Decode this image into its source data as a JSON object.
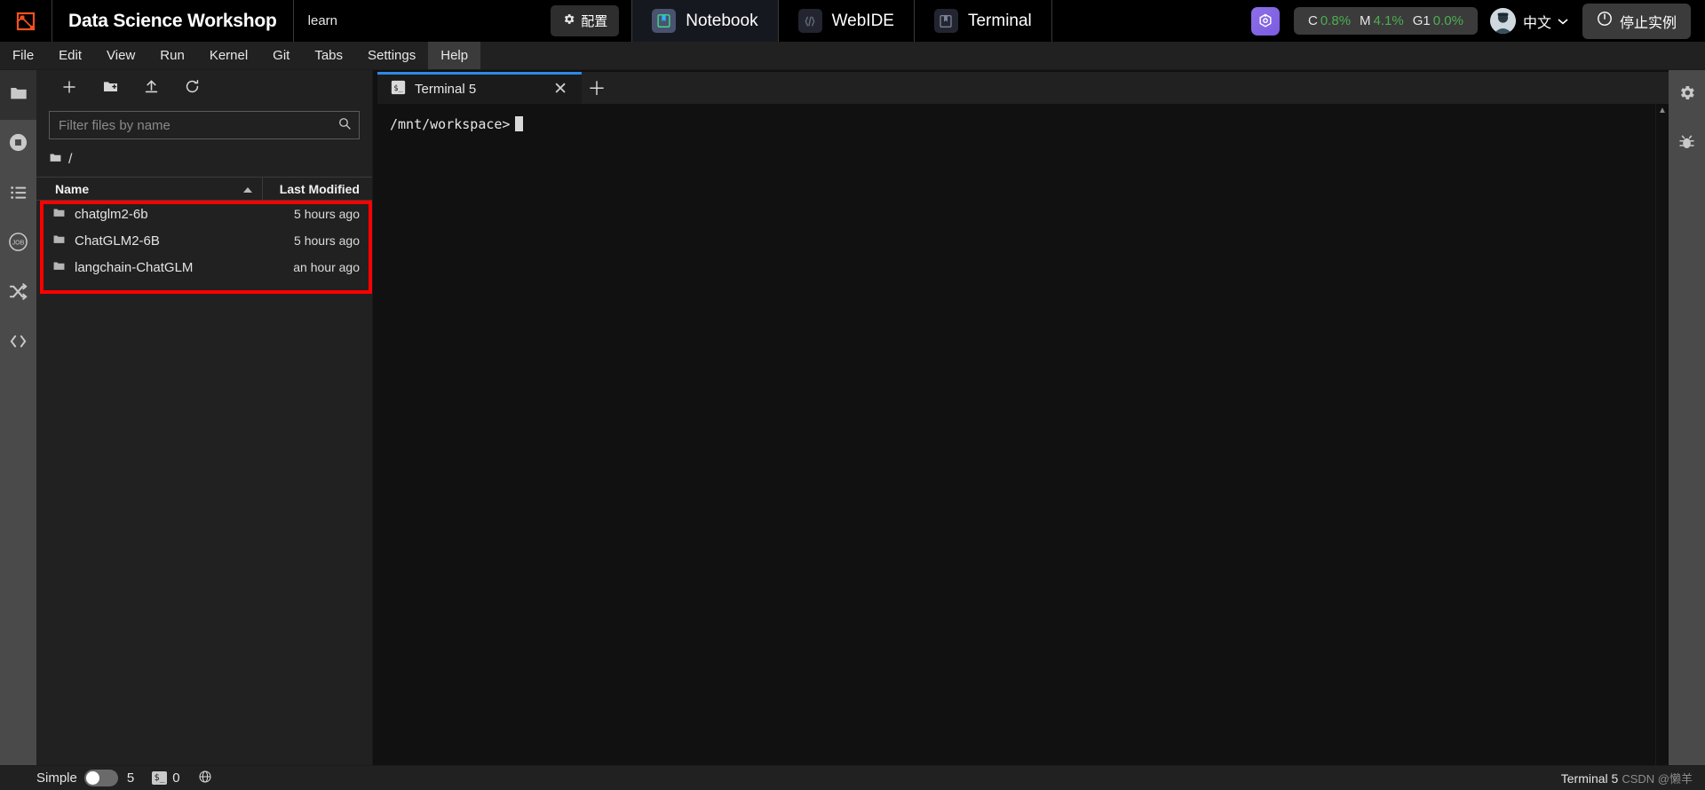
{
  "topbar": {
    "logo_icon": "workshop-logo-icon",
    "title": "Data Science Workshop",
    "subtitle": "learn",
    "config_button": {
      "label": "配置",
      "icon": "gear-icon"
    },
    "apps": [
      {
        "label": "Notebook",
        "icon": "notebook-icon",
        "active": true
      },
      {
        "label": "WebIDE",
        "icon": "code-brackets-icon",
        "active": false
      },
      {
        "label": "Terminal",
        "icon": "terminal-app-icon",
        "active": false
      }
    ],
    "ai_assistant_icon": "ai-assistant-icon",
    "stats": [
      {
        "key": "C",
        "value": "0.8%"
      },
      {
        "key": "M",
        "value": "4.1%"
      },
      {
        "key": "G1",
        "value": "0.0%"
      }
    ],
    "stats_value_color": "#4caf50",
    "avatar_icon": "user-avatar",
    "language": {
      "label": "中文",
      "icon": "chevron-down-icon"
    },
    "stop_button": {
      "label": "停止实例",
      "icon": "power-icon"
    }
  },
  "menubar": {
    "items": [
      {
        "label": "File",
        "active": false
      },
      {
        "label": "Edit",
        "active": false
      },
      {
        "label": "View",
        "active": false
      },
      {
        "label": "Run",
        "active": false
      },
      {
        "label": "Kernel",
        "active": false
      },
      {
        "label": "Git",
        "active": false
      },
      {
        "label": "Tabs",
        "active": false
      },
      {
        "label": "Settings",
        "active": false
      },
      {
        "label": "Help",
        "active": true
      }
    ]
  },
  "left_rail": {
    "items": [
      {
        "name": "file-browser",
        "icon": "folder-icon",
        "active": true
      },
      {
        "name": "running-terminals",
        "icon": "stop-circle-icon",
        "active": false
      },
      {
        "name": "table-of-contents",
        "icon": "list-icon",
        "active": false
      },
      {
        "name": "jobs",
        "icon": "job-icon",
        "active": false
      },
      {
        "name": "extension-manager",
        "icon": "shuffle-icon",
        "active": false
      },
      {
        "name": "code-snippets",
        "icon": "code-tags-icon",
        "active": false
      }
    ]
  },
  "right_rail": {
    "items": [
      {
        "name": "property-inspector",
        "icon": "gear-icon"
      },
      {
        "name": "debugger",
        "icon": "bug-icon"
      }
    ]
  },
  "file_browser": {
    "toolbar": [
      {
        "name": "new-launcher",
        "icon": "plus-icon"
      },
      {
        "name": "new-folder",
        "icon": "new-folder-icon"
      },
      {
        "name": "upload-files",
        "icon": "upload-icon"
      },
      {
        "name": "refresh-file-list",
        "icon": "refresh-icon"
      }
    ],
    "filter": {
      "placeholder": "Filter files by name",
      "value": "",
      "icon": "search-icon"
    },
    "breadcrumb": {
      "root_icon": "folder-icon",
      "path": "/"
    },
    "columns": {
      "name": "Name",
      "sort_indicator": "sort-ascending-icon",
      "last_modified": "Last Modified"
    },
    "rows": [
      {
        "icon": "folder-icon",
        "name": "chatglm2-6b",
        "modified": "5 hours ago"
      },
      {
        "icon": "folder-icon",
        "name": "ChatGLM2-6B",
        "modified": "5 hours ago"
      },
      {
        "icon": "folder-icon",
        "name": "langchain-ChatGLM",
        "modified": "an hour ago"
      }
    ],
    "highlight_color": "#ff0000"
  },
  "main": {
    "tab": {
      "label": "Terminal 5",
      "icon": "terminal-icon",
      "close_icon": "close-icon"
    },
    "add_tab_icon": "plus-icon",
    "terminal": {
      "prompt": "/mnt/workspace>",
      "cursor": "block-cursor"
    },
    "scrollbar": {
      "up_icon": "triangle-up-icon",
      "down_icon": "triangle-down-icon"
    }
  },
  "statusbar": {
    "simple_label": "Simple",
    "toggle_on": false,
    "kernel_count": "5",
    "terminal_icon": "terminal-small-icon",
    "terminal_count": "0",
    "globe_icon": "globe-icon",
    "right_label": "Terminal 5",
    "watermark": "CSDN @懒羊"
  }
}
